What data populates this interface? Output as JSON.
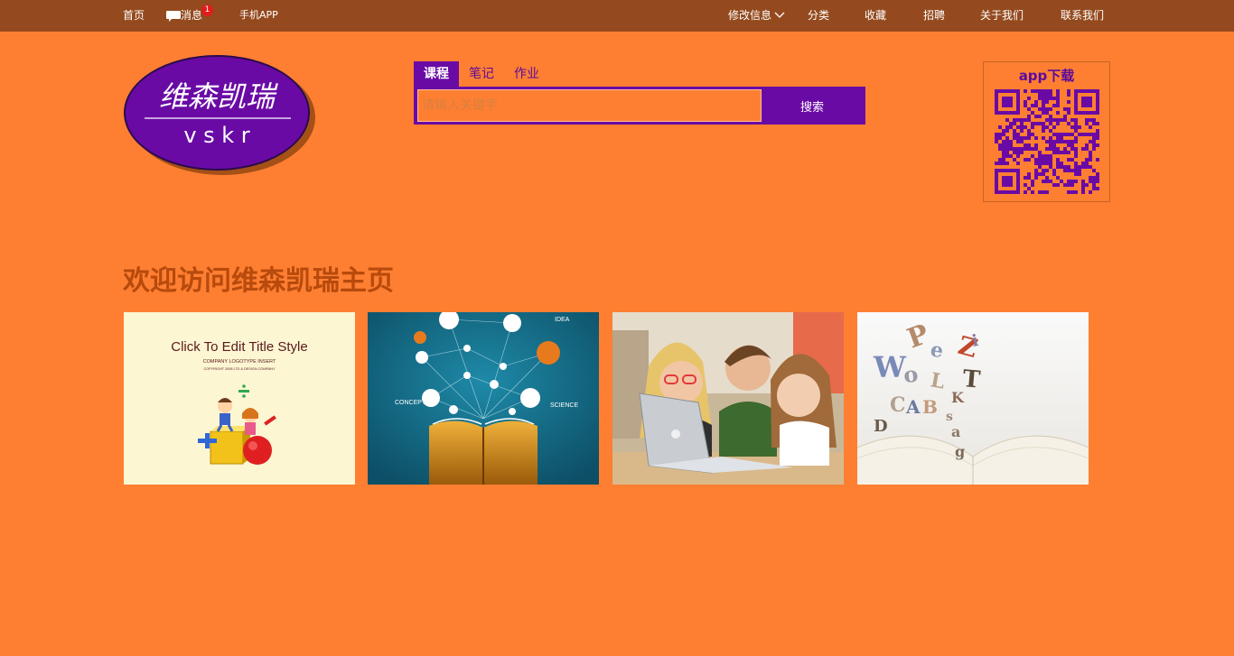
{
  "topbar": {
    "home": "首页",
    "messages": "消息",
    "message_count": "1",
    "app": "手机APP",
    "edit_info": "修改信息",
    "category": "分类",
    "favorites": "收藏",
    "jobs": "招聘",
    "about": "关于我们",
    "contact": "联系我们"
  },
  "logo": {
    "cn": "维森凯瑞",
    "en": "v s k r"
  },
  "search": {
    "tabs": [
      "课程",
      "笔记",
      "作业"
    ],
    "active_tab": "课程",
    "placeholder": "请输入关键字",
    "button": "搜索"
  },
  "qr": {
    "title": "app下载"
  },
  "main": {
    "welcome": "欢迎访问维森凯瑞主页"
  },
  "tiles": [
    {
      "headline": "Click To Edit Title Style",
      "sub1": "COMPANY LOGOTYPE INSERT",
      "sub2": "COPYRIGHT 2008 LTD & DESIGN COMPANY"
    },
    {
      "idea": "IDEA",
      "concept": "CONCEPT",
      "science": "SCIENCE"
    },
    {},
    {
      "letters": [
        "P",
        "e",
        "Z",
        "i",
        "W",
        "o",
        "L",
        "T",
        "C",
        "A",
        "B",
        "K",
        "D",
        "s",
        "a",
        "g"
      ]
    }
  ],
  "colors": {
    "background": "#ff7f32",
    "topbar": "#944a1e",
    "accent_purple": "#6a0aa5",
    "heading": "#b74a0c"
  }
}
